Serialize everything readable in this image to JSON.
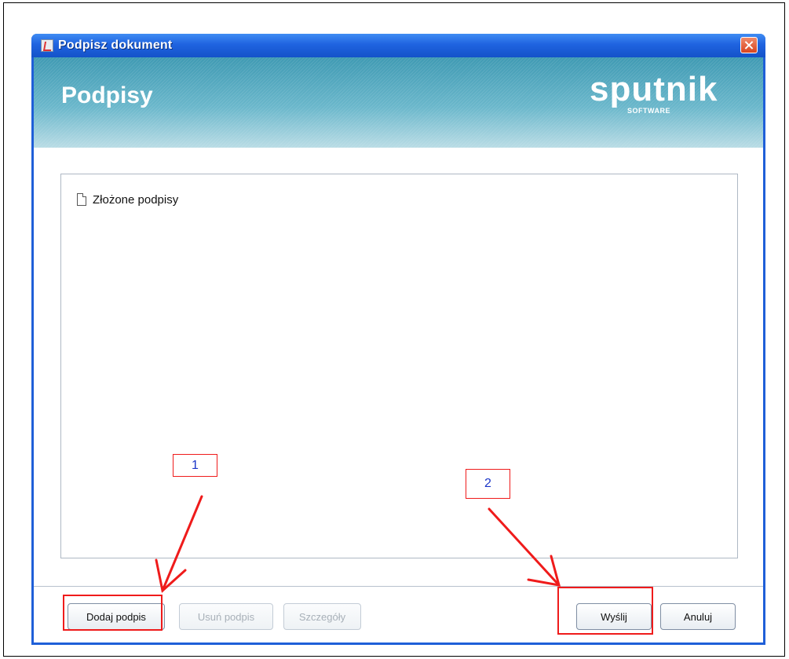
{
  "window": {
    "title": "Podpisz dokument",
    "banner_title": "Podpisy",
    "logo_text": "sputnik",
    "logo_subtext": "SOFTWARE",
    "app_icon": "java-cup-icon",
    "close_icon": "close-icon",
    "accent": "#1f5fd8"
  },
  "tree": {
    "items": [
      {
        "label": "Złożone podpisy",
        "icon": "document-icon"
      }
    ]
  },
  "buttons": {
    "add": "Dodaj podpis",
    "remove": "Usuń podpis",
    "details": "Szczegóły",
    "send": "Wyślij",
    "cancel": "Anuluj"
  },
  "annotations": {
    "label_1": "1",
    "label_2": "2",
    "color": "#ef1b1b"
  }
}
